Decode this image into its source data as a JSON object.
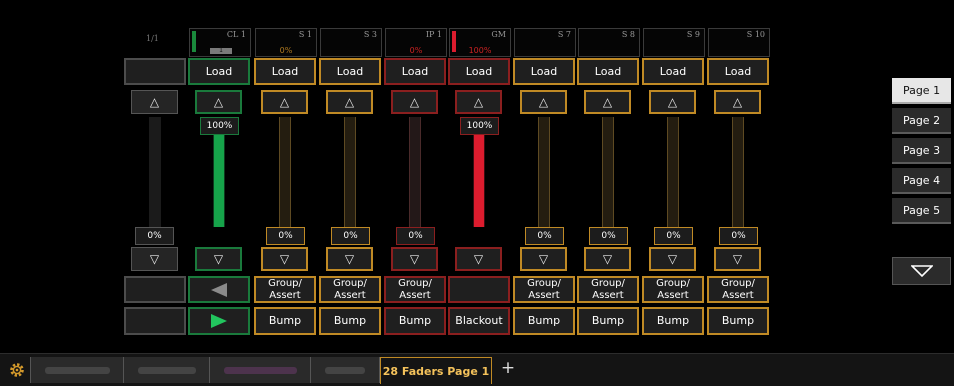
{
  "page_index": "1/1",
  "columns": [
    {
      "code": "CL 1",
      "level": "",
      "load": "Load",
      "level_pct": "100%",
      "fill": 1.0,
      "mid": "◀",
      "bottom": "▶",
      "kind": "green"
    },
    {
      "code": "S 1",
      "level": "0%",
      "load": "Load",
      "level_pct": "0%",
      "fill": 0,
      "mid": "Group/ Assert",
      "bottom": "Bump",
      "kind": "gold"
    },
    {
      "code": "S 3",
      "level": "",
      "load": "Load",
      "level_pct": "0%",
      "fill": 0,
      "mid": "Group/ Assert",
      "bottom": "Bump",
      "kind": "gold"
    },
    {
      "code": "IP 1",
      "level": "0%",
      "load": "Load",
      "level_pct": "0%",
      "fill": 0,
      "mid": "Group/ Assert",
      "bottom": "Bump",
      "kind": "red"
    },
    {
      "code": "GM",
      "level": "100%",
      "load": "Load",
      "level_pct": "100%",
      "fill": 1.0,
      "mid": "",
      "bottom": "Blackout",
      "kind": "redgm"
    },
    {
      "code": "S 7",
      "level": "",
      "load": "Load",
      "level_pct": "0%",
      "fill": 0,
      "mid": "Group/ Assert",
      "bottom": "Bump",
      "kind": "gold"
    },
    {
      "code": "S 8",
      "level": "",
      "load": "Load",
      "level_pct": "0%",
      "fill": 0,
      "mid": "Group/ Assert",
      "bottom": "Bump",
      "kind": "gold"
    },
    {
      "code": "S 9",
      "level": "",
      "load": "Load",
      "level_pct": "0%",
      "fill": 0,
      "mid": "Group/ Assert",
      "bottom": "Bump",
      "kind": "gold"
    },
    {
      "code": "S 10",
      "level": "",
      "load": "Load",
      "level_pct": "0%",
      "fill": 0,
      "mid": "Group/ Assert",
      "bottom": "Bump",
      "kind": "gold"
    }
  ],
  "first_column": {
    "level_pct": "0%",
    "up": "△",
    "down": "▽"
  },
  "arrows": {
    "up": "△",
    "down": "▽"
  },
  "pages": [
    "Page 1",
    "Page 2",
    "Page 3",
    "Page 4",
    "Page 5"
  ],
  "page_down": "▽",
  "tabs": {
    "active": "28 Faders Page 1",
    "add": "+"
  },
  "icons": {
    "settings": "gear-icon"
  },
  "colors": {
    "gold": "#c08a25",
    "red": "#8b1f1f",
    "green": "#1a7a3c",
    "fader_green": "#16a34a",
    "fader_red": "#dc1c2e"
  }
}
